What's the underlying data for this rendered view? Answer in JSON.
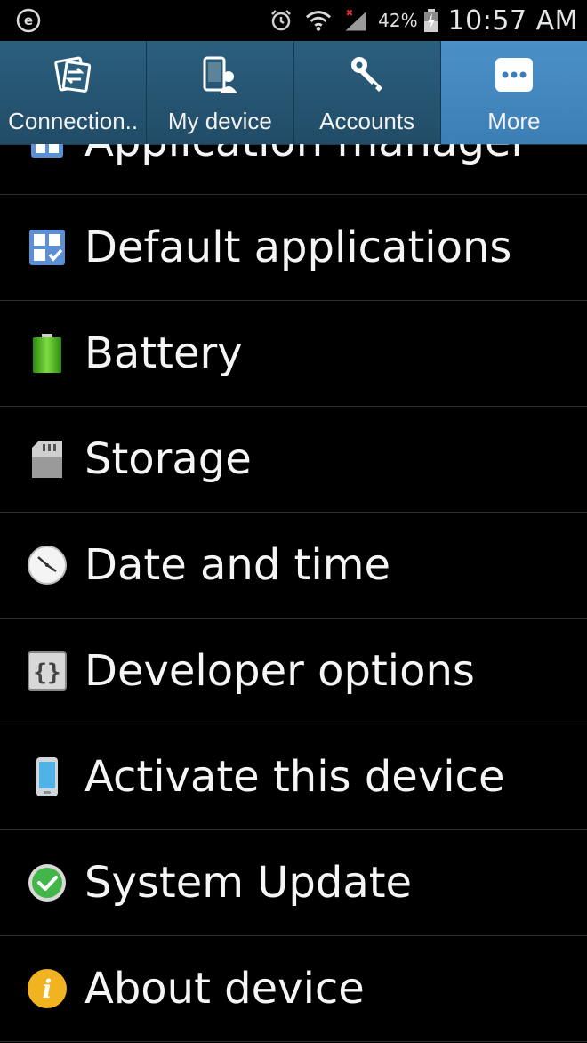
{
  "status_bar": {
    "left_icon": "e-notification-icon",
    "icons": [
      "alarm-icon",
      "wifi-icon",
      "signal-no-data-icon",
      "battery-charging-icon"
    ],
    "battery_percent": "42%",
    "time": "10:57 AM"
  },
  "tabs": [
    {
      "label": "Connection..",
      "icon": "connections-icon",
      "active": false
    },
    {
      "label": "My device",
      "icon": "my-device-icon",
      "active": false
    },
    {
      "label": "Accounts",
      "icon": "accounts-key-icon",
      "active": false
    },
    {
      "label": "More",
      "icon": "more-dots-icon",
      "active": true
    }
  ],
  "items": [
    {
      "label": "Application manager",
      "icon": "application-manager-icon"
    },
    {
      "label": "Default applications",
      "icon": "default-applications-icon"
    },
    {
      "label": "Battery",
      "icon": "battery-icon"
    },
    {
      "label": "Storage",
      "icon": "storage-icon"
    },
    {
      "label": "Date and time",
      "icon": "clock-icon"
    },
    {
      "label": "Developer options",
      "icon": "developer-options-icon"
    },
    {
      "label": "Activate this device",
      "icon": "phone-icon"
    },
    {
      "label": "System Update",
      "icon": "check-circle-icon"
    },
    {
      "label": "About device",
      "icon": "info-icon"
    }
  ],
  "colors": {
    "tab_bg": "#2b5f7e",
    "tab_active_bg": "#4a90c6",
    "list_bg": "#000000",
    "divider": "#2f2f2f"
  }
}
